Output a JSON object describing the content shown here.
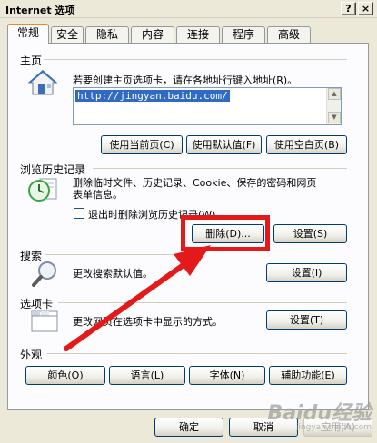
{
  "window": {
    "title": "Internet 选项",
    "help_label": "?",
    "close_label": "×"
  },
  "tabs": [
    "常规",
    "安全",
    "隐私",
    "内容",
    "连接",
    "程序",
    "高级"
  ],
  "homepage": {
    "label": "主页",
    "desc": "若要创建主页选项卡，请在各地址行键入地址(R)。",
    "url": "http://jingyan.baidu.com/",
    "use_current": "使用当前页(C)",
    "use_default": "使用默认值(F)",
    "use_blank": "使用空白页(B)"
  },
  "history": {
    "label": "浏览历史记录",
    "desc_line1": "删除临时文件、历史记录、Cookie、保存的密码和网页",
    "desc_line2": "表单信息。",
    "checkbox_label": "退出时删除浏览历史记录(W)",
    "delete_button": "删除(D)...",
    "settings_button": "设置(S)"
  },
  "search": {
    "label": "搜索",
    "desc": "更改搜索默认值。",
    "settings_button": "设置(I)"
  },
  "tabs_section": {
    "label": "选项卡",
    "desc": "更改网页在选项卡中显示的方式。",
    "settings_button": "设置(T)"
  },
  "appearance": {
    "label": "外观",
    "colors": "颜色(O)",
    "languages": "语言(L)",
    "fonts": "字体(N)",
    "accessibility": "辅助功能(E)"
  },
  "footer": {
    "ok": "确定",
    "cancel": "取消",
    "apply": "应用(A)"
  },
  "watermark": {
    "main": "Baidu经验",
    "sub": "jingyan.baidu.com"
  },
  "colors": {
    "highlight": "#e41a1a",
    "selection": "#316ac5"
  }
}
